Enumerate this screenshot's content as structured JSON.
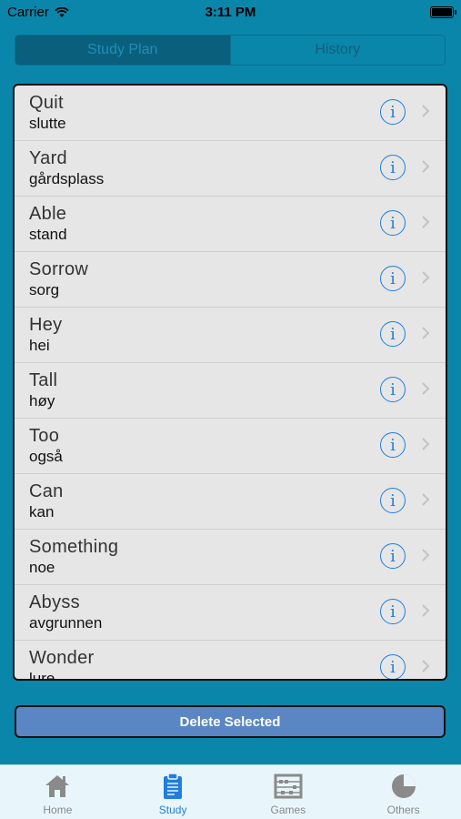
{
  "status_bar": {
    "carrier": "Carrier",
    "time": "3:11 PM"
  },
  "segments": [
    {
      "label": "Study Plan",
      "active": true
    },
    {
      "label": "History",
      "active": false
    }
  ],
  "study_list": [
    {
      "word": "Quit",
      "translation": "slutte"
    },
    {
      "word": "Yard",
      "translation": "gårdsplass"
    },
    {
      "word": "Able",
      "translation": "stand"
    },
    {
      "word": "Sorrow",
      "translation": "sorg"
    },
    {
      "word": "Hey",
      "translation": "hei"
    },
    {
      "word": "Tall",
      "translation": "høy"
    },
    {
      "word": "Too",
      "translation": "også"
    },
    {
      "word": "Can",
      "translation": "kan"
    },
    {
      "word": "Something",
      "translation": "noe"
    },
    {
      "word": "Abyss",
      "translation": "avgrunnen"
    },
    {
      "word": "Wonder",
      "translation": "lure"
    }
  ],
  "info_glyph": "i",
  "delete_button": {
    "label": "Delete Selected"
  },
  "tabs": [
    {
      "label": "Home",
      "icon": "home-icon",
      "active": false
    },
    {
      "label": "Study",
      "icon": "clipboard-icon",
      "active": true
    },
    {
      "label": "Games",
      "icon": "abacus-icon",
      "active": false
    },
    {
      "label": "Others",
      "icon": "pie-icon",
      "active": false
    }
  ],
  "colors": {
    "background": "#0a86aa",
    "accent": "#1f7ee0",
    "button": "#5a86c4"
  }
}
